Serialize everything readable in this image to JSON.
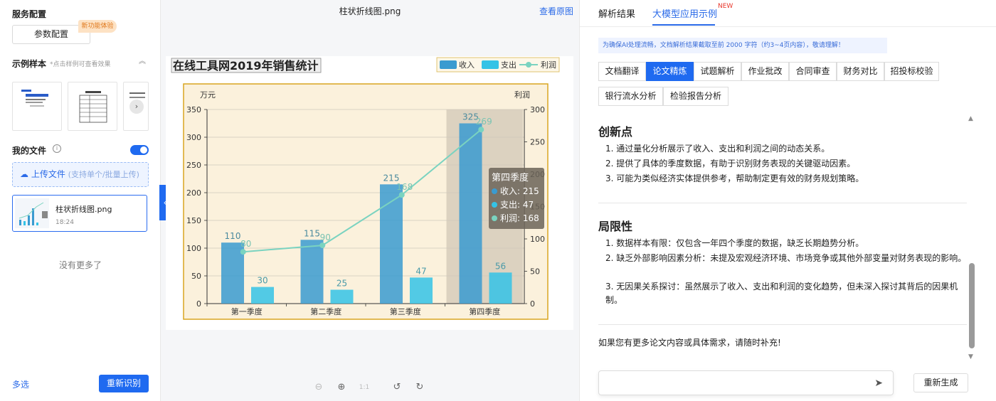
{
  "left": {
    "service_title": "服务配置",
    "param_button": "参数配置",
    "new_badge": "新功能体验",
    "sample_title": "示例样本",
    "sample_hint": "*点击样例可查看效果",
    "myfiles_title": "我的文件",
    "upload_label": "上传文件",
    "upload_sub": "(支持单个/批量上传)",
    "file": {
      "name": "柱状折线图.png",
      "time": "18:24"
    },
    "no_more": "没有更多了",
    "multi_select": "多选",
    "reidentify": "重新识别"
  },
  "middle": {
    "title": "柱状折线图.png",
    "view_original": "查看原图"
  },
  "right": {
    "tabs": [
      {
        "label": "解析结果"
      },
      {
        "label": "大模型应用示例"
      }
    ],
    "new_sup": "NEW",
    "notice": "为确保AI处理流畅，文档解析结果截取至前 2000 字符（约3~4页内容），敬请理解！",
    "tab_buttons": [
      {
        "label": "文档翻译"
      },
      {
        "label": "论文精炼"
      },
      {
        "label": "试题解析"
      },
      {
        "label": "作业批改"
      },
      {
        "label": "合同审查"
      },
      {
        "label": "财务对比"
      },
      {
        "label": "招投标校验"
      },
      {
        "label": "银行流水分析"
      },
      {
        "label": "检验报告分析"
      }
    ],
    "sections": [
      {
        "heading": "创新点",
        "items": [
          "1. 通过量化分析展示了收入、支出和利润之间的动态关系。",
          "2. 提供了具体的季度数据，有助于识别财务表现的关键驱动因素。",
          "3. 可能为类似经济实体提供参考，帮助制定更有效的财务规划策略。"
        ]
      },
      {
        "heading": "局限性",
        "items": [
          "1. 数据样本有限：仅包含一年四个季度的数据，缺乏长期趋势分析。",
          "2. 缺乏外部影响因素分析：未提及宏观经济环境、市场竞争或其他外部变量对财务表现的影响。",
          "3. 无因果关系探讨：虽然展示了收入、支出和利润的变化趋势，但未深入探讨其背后的因果机制。"
        ]
      }
    ],
    "closing": "如果您有更多论文内容或具体需求，请随时补充!",
    "regenerate": "重新生成"
  },
  "chart_data": {
    "type": "bar",
    "title": "在线工具网2019年销售统计",
    "categories": [
      "第一季度",
      "第二季度",
      "第三季度",
      "第四季度"
    ],
    "series": [
      {
        "name": "收入",
        "type": "bar",
        "values": [
          110,
          115,
          215,
          325
        ],
        "color": "#3a9bd0"
      },
      {
        "name": "支出",
        "type": "bar",
        "values": [
          30,
          25,
          47,
          56
        ],
        "color": "#34c3e6"
      },
      {
        "name": "利润",
        "type": "line",
        "axis": "right",
        "values": [
          80,
          90,
          168,
          269
        ],
        "color": "#7ad3c0"
      }
    ],
    "ylabel": "万元",
    "ylabel_right": "利润",
    "ylim": [
      0,
      350
    ],
    "ylim_right": [
      0,
      300
    ],
    "yticks": [
      0,
      50,
      100,
      150,
      200,
      250,
      300,
      350
    ],
    "yticks_right": [
      0,
      50,
      100,
      150,
      200,
      250,
      300
    ],
    "legend": "top-right",
    "grid": true,
    "tooltip": {
      "title": "第四季度",
      "lines": [
        "收入: 215",
        "支出: 47",
        "利润: 168"
      ]
    }
  }
}
